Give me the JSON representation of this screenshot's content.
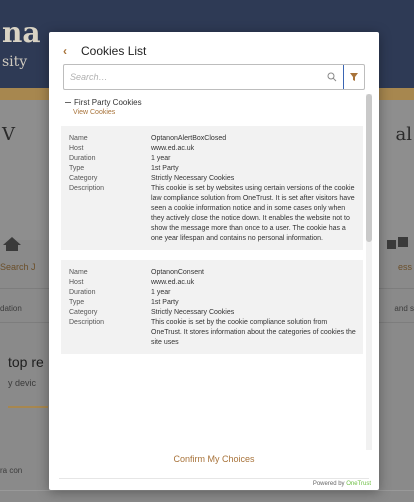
{
  "background": {
    "brand_line1": "na",
    "brand_line2": "sity",
    "letter_left": "V",
    "letter_right": "al",
    "search_label": "Search J",
    "right_label": "ess",
    "small_left": "dation",
    "small_right": "and s",
    "top_heading": "top re",
    "top_sub": "y devic",
    "lower_text": "ra con"
  },
  "modal": {
    "title": "Cookies List",
    "back_icon": "chevron-left-icon",
    "search_placeholder": "Search…",
    "group_title": "First Party Cookies",
    "view_cookies": "View Cookies",
    "confirm_label": "Confirm My Choices",
    "powered_by": "Powered by",
    "powered_brand": "OneTrust",
    "accent_color": "#a8733a",
    "brand_color": "#6cbf42"
  },
  "cookies": [
    {
      "name_label": "Name",
      "name": "OptanonAlertBoxClosed",
      "host_label": "Host",
      "host": "www.ed.ac.uk",
      "duration_label": "Duration",
      "duration": "1 year",
      "type_label": "Type",
      "type": "1st Party",
      "category_label": "Category",
      "category": "Strictly Necessary Cookies",
      "description_label": "Description",
      "description": "This cookie is set by websites using certain versions of the cookie law compliance solution from OneTrust. It is set after visitors have seen a cookie information notice and in some cases only when they actively close the notice down. It enables the website not to show the message more than once to a user. The cookie has a one year lifespan and contains no personal information."
    },
    {
      "name_label": "Name",
      "name": "OptanonConsent",
      "host_label": "Host",
      "host": "www.ed.ac.uk",
      "duration_label": "Duration",
      "duration": "1 year",
      "type_label": "Type",
      "type": "1st Party",
      "category_label": "Category",
      "category": "Strictly Necessary Cookies",
      "description_label": "Description",
      "description": "This cookie is set by the cookie compliance solution from OneTrust. It stores information about the categories of cookies the site uses"
    }
  ]
}
